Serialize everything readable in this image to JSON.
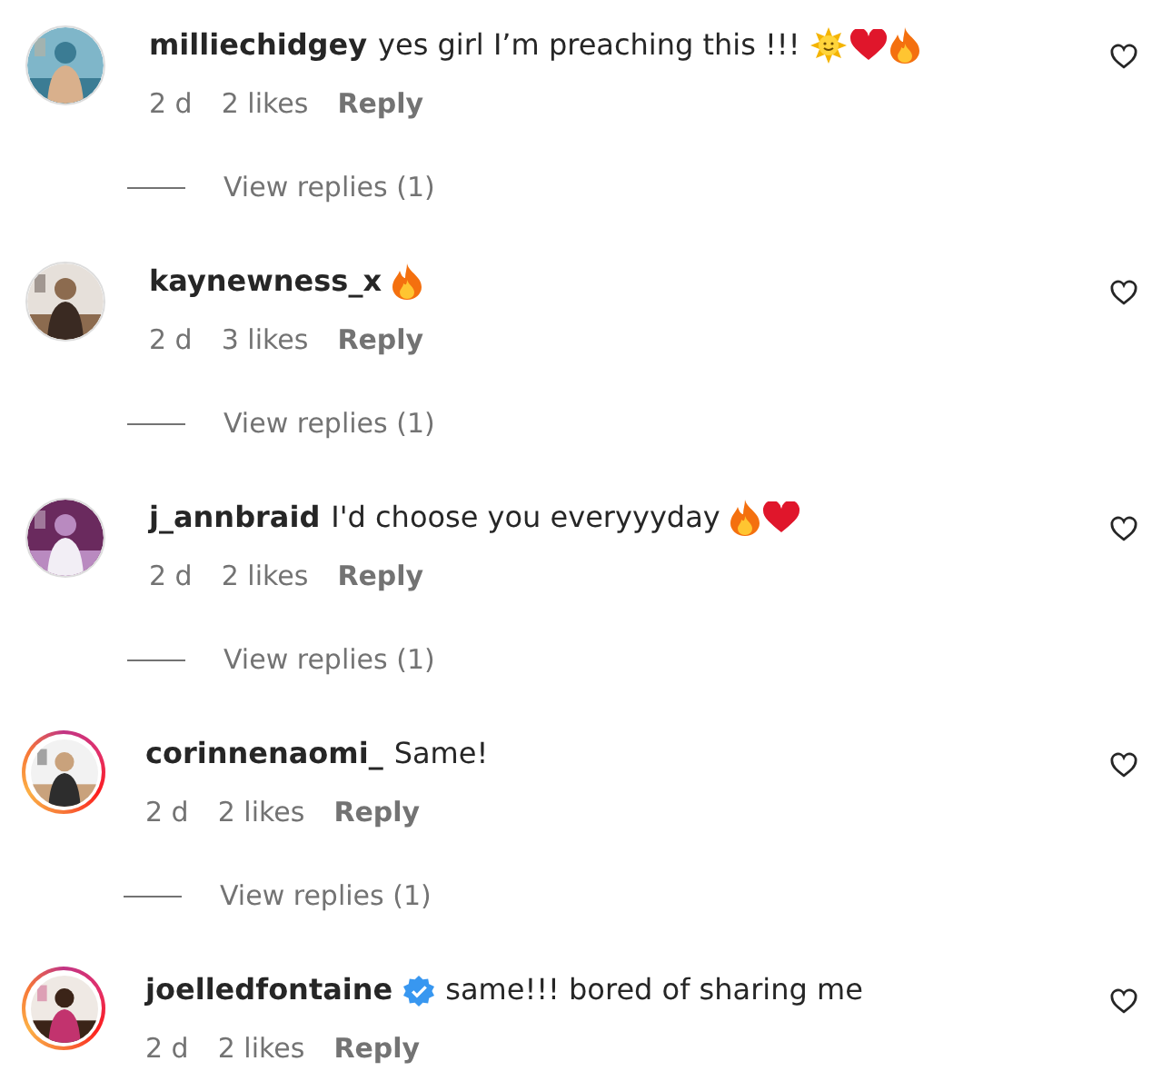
{
  "comments": [
    {
      "username": "milliechidgey",
      "verified": false,
      "story_ring": false,
      "avatar": {
        "kind": "picture"
      },
      "text": "yes girl I’m preaching this !!!",
      "emojis": [
        {
          "kind": "sun"
        },
        {
          "kind": "heart"
        },
        {
          "kind": "fire"
        }
      ],
      "time": "2 d",
      "likes": "2 likes",
      "reply": "Reply",
      "view_replies": "View replies (1)"
    },
    {
      "username": "kaynewness_x",
      "verified": false,
      "story_ring": false,
      "avatar": {
        "kind": "picture"
      },
      "emojis": [
        {
          "kind": "fire"
        }
      ],
      "time": "2 d",
      "likes": "3 likes",
      "reply": "Reply",
      "view_replies": "View replies (1)"
    },
    {
      "username": "j_annbraid",
      "verified": false,
      "story_ring": false,
      "avatar": {
        "kind": "picture"
      },
      "text": "I'd choose you everyyyday",
      "emojis": [
        {
          "kind": "fire"
        },
        {
          "kind": "heart"
        }
      ],
      "time": "2 d",
      "likes": "2 likes",
      "reply": "Reply",
      "view_replies": "View replies (1)"
    },
    {
      "username": "corinnenaomi_",
      "verified": false,
      "story_ring": true,
      "avatar": {
        "kind": "picture"
      },
      "text": "Same!",
      "time": "2 d",
      "likes": "2 likes",
      "reply": "Reply",
      "view_replies": "View replies (1)"
    },
    {
      "username": "joelledfontaine",
      "verified": true,
      "story_ring": true,
      "avatar": {
        "kind": "picture"
      },
      "text": "same!!! bored of sharing me",
      "time": "2 d",
      "likes": "2 likes",
      "reply": "Reply"
    }
  ]
}
